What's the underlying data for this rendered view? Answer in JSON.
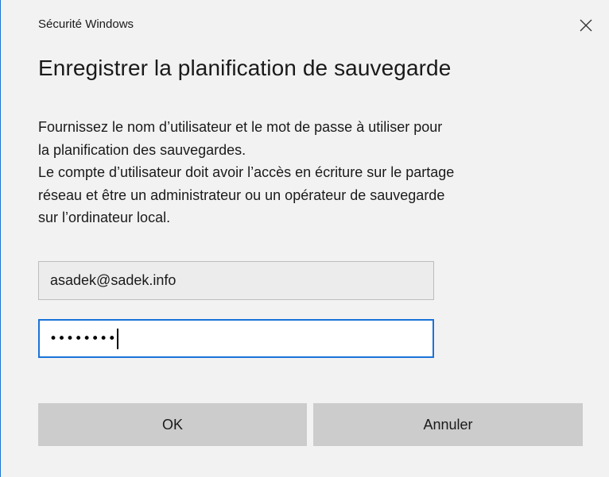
{
  "window": {
    "title": "Sécurité Windows",
    "close_icon": "close-icon"
  },
  "dialog": {
    "heading": "Enregistrer la planification de sauvegarde",
    "description_lines": [
      "Fournissez le nom d’utilisateur et le mot de passe à utiliser pour",
      "la planification des sauvegardes.",
      "Le compte d’utilisateur doit avoir l’accès en écriture sur le partage",
      "réseau et être un administrateur ou un opérateur de sauvegarde",
      "sur l’ordinateur local."
    ]
  },
  "form": {
    "username_value": "asadek@sadek.info",
    "password_mask": "••••••••"
  },
  "buttons": {
    "ok_label": "OK",
    "cancel_label": "Annuler"
  },
  "colors": {
    "accent": "#1a73d8",
    "background": "#f2f2f2",
    "button_background": "#cccccc"
  }
}
